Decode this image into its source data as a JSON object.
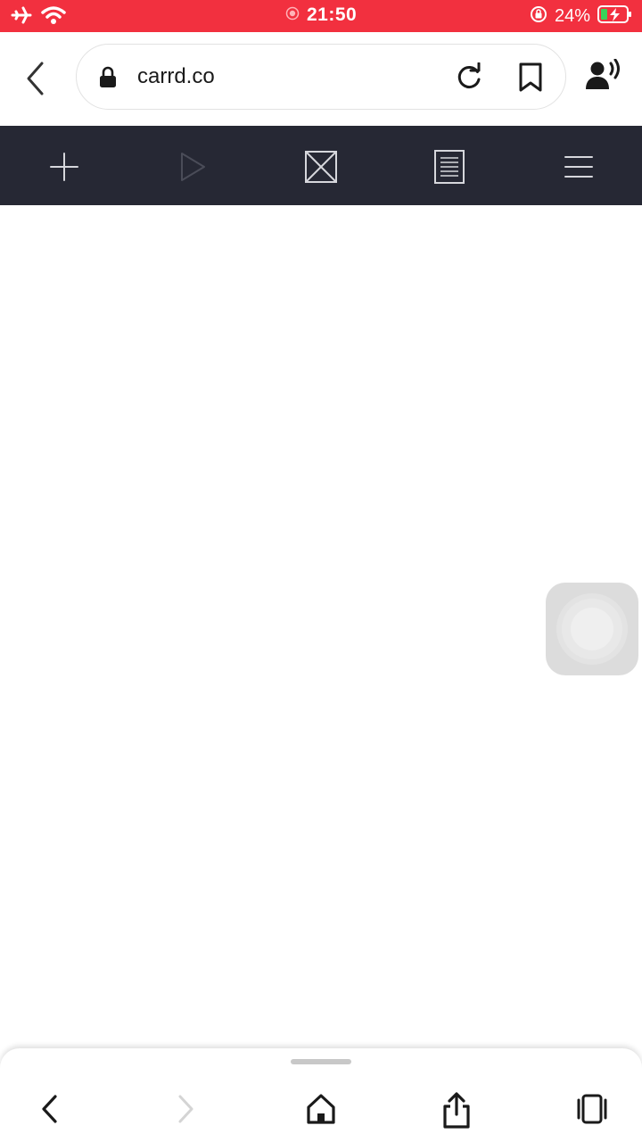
{
  "status_bar": {
    "time": "21:50",
    "battery_percent": "24%",
    "background_color": "#f2303f",
    "icons": [
      "airplane-icon",
      "wifi-icon",
      "recording-icon",
      "orientation-lock-icon",
      "battery-charging-icon"
    ]
  },
  "browser": {
    "url": "carrd.co",
    "icons": [
      "back-icon",
      "lock-icon",
      "reload-icon",
      "bookmark-icon",
      "speaker-user-icon"
    ]
  },
  "editor_toolbar": {
    "background_color": "#262834",
    "buttons": [
      "add-icon",
      "play-icon",
      "image-placeholder-icon",
      "page-icon",
      "menu-icon"
    ]
  },
  "bottom_nav": {
    "buttons": [
      "nav-back-icon",
      "nav-forward-icon",
      "home-icon",
      "share-icon",
      "tabs-icon"
    ]
  }
}
